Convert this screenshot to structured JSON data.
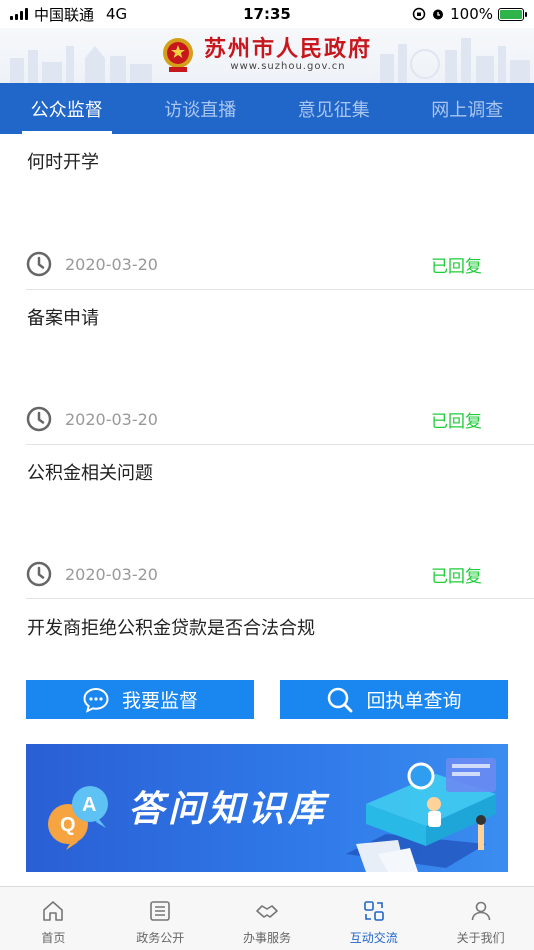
{
  "status_bar": {
    "carrier": "中国联通",
    "network": "4G",
    "time": "17:35",
    "battery": "100%"
  },
  "header": {
    "title": "苏州市人民政府",
    "url": "www.suzhou.gov.cn"
  },
  "tabs": [
    {
      "label": "公众监督",
      "active": true
    },
    {
      "label": "访谈直播",
      "active": false
    },
    {
      "label": "意见征集",
      "active": false
    },
    {
      "label": "网上调查",
      "active": false
    }
  ],
  "items": [
    {
      "title": "何时开学",
      "date": "2020-03-20",
      "status": "已回复"
    },
    {
      "title": "备案申请",
      "date": "2020-03-20",
      "status": "已回复"
    },
    {
      "title": "公积金相关问题",
      "date": "2020-03-20",
      "status": "已回复"
    },
    {
      "title": "开发商拒绝公积金贷款是否合法合规"
    }
  ],
  "actions": {
    "supervise": "我要监督",
    "receipt_query": "回执单查询"
  },
  "banner": {
    "title": "答问知识库",
    "badge_q": "Q",
    "badge_a": "A"
  },
  "bottom_tabs": [
    {
      "label": "首页",
      "icon": "home-icon"
    },
    {
      "label": "政务公开",
      "icon": "document-icon"
    },
    {
      "label": "办事服务",
      "icon": "handshake-icon"
    },
    {
      "label": "互动交流",
      "icon": "exchange-icon",
      "active": true
    },
    {
      "label": "关于我们",
      "icon": "user-icon"
    }
  ],
  "colors": {
    "primary": "#2166c9",
    "button": "#1a87f0",
    "status_green": "#22cc3a",
    "brand_red": "#c8161d"
  }
}
